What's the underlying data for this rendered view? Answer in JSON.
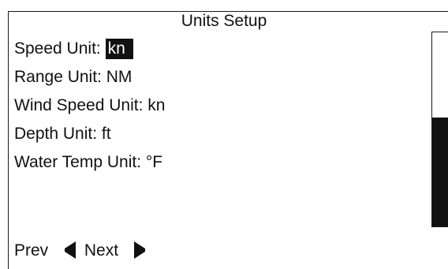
{
  "screen": {
    "title": "Units Setup"
  },
  "menu": {
    "items": [
      {
        "label": "Speed Unit:",
        "value": "kn",
        "selected": true
      },
      {
        "label": "Range Unit:",
        "value": "NM",
        "selected": false
      },
      {
        "label": "Wind Speed Unit:",
        "value": "kn",
        "selected": false
      },
      {
        "label": "Depth Unit:",
        "value": "ft",
        "selected": false
      },
      {
        "label": "Water Temp Unit:",
        "value": "°F",
        "selected": false
      }
    ]
  },
  "scrollbar": {
    "thumb_fraction": 0.56
  },
  "footer": {
    "prev_label": "Prev",
    "next_label": "Next"
  },
  "icons": {
    "prev": "triangle-left-icon",
    "next": "triangle-right-icon"
  },
  "colors": {
    "text": "#111111",
    "background": "#ffffff",
    "highlight_background": "#111111",
    "highlight_text": "#ffffff"
  }
}
